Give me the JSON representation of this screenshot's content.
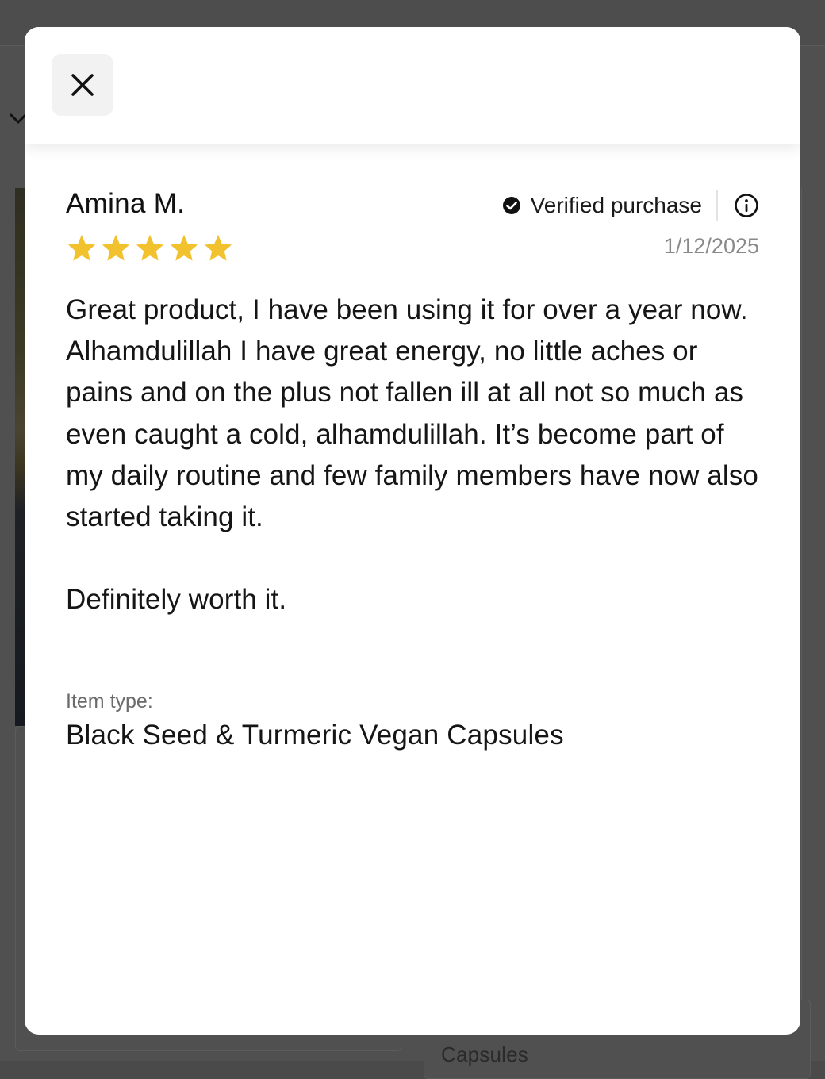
{
  "background": {
    "caption_fragment": "Capsules"
  },
  "modal": {
    "close_icon": "close-icon",
    "review": {
      "reviewer_name": "Amina M.",
      "verified_label": "Verified purchase",
      "verified_icon": "check-circle-icon",
      "info_icon": "info-icon",
      "rating": 5,
      "rating_max": 5,
      "star_color": "#f2c12e",
      "date": "1/12/2025",
      "body_paragraphs": [
        "Great product, I have been using it for over a year now. Alhamdulillah I have great energy, no little aches or pains and on the plus not fallen ill at all not so much as even caught a cold, alhamdulillah. It’s become part of my daily routine and few family members have now also started taking it.",
        "Definitely worth it."
      ],
      "item_type_label": "Item type:",
      "item_type_value": "Black Seed & Turmeric Vegan Capsules"
    }
  }
}
